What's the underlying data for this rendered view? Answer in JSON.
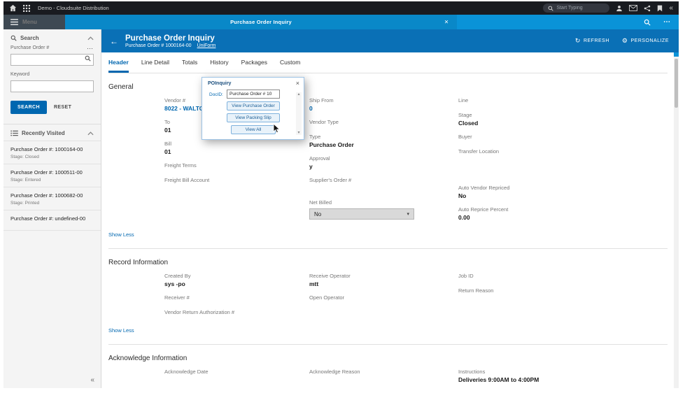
{
  "topbar": {
    "app_title": "Demo - Cloudsuite Distribution",
    "search_placeholder": "Start Typing"
  },
  "menubar": {
    "menu_label": "Menu",
    "tab_title": "Purchase Order Inquiry"
  },
  "page_header": {
    "title": "Purchase Order Inquiry",
    "subtitle": "Purchase Order #  1000164-00",
    "uniform_link": "UniForm",
    "refresh": "REFRESH",
    "personalize": "PERSONALIZE"
  },
  "sidebar": {
    "search_title": "Search",
    "po_number_label": "Purchase Order #",
    "keyword_label": "Keyword",
    "search_button": "SEARCH",
    "reset_button": "RESET",
    "recently_visited_title": "Recently Visited",
    "recent": [
      {
        "title": "Purchase Order #: 1000164-00",
        "stage": "Stage: Closed"
      },
      {
        "title": "Purchase Order #: 1000511-00",
        "stage": "Stage: Entered"
      },
      {
        "title": "Purchase Order #: 1000682-00",
        "stage": "Stage: Printed"
      },
      {
        "title": "Purchase Order #: undefined-00",
        "stage": ""
      }
    ]
  },
  "tabs": {
    "header": "Header",
    "line_detail": "Line Detail",
    "totals": "Totals",
    "history": "History",
    "packages": "Packages",
    "custom": "Custom"
  },
  "sections": {
    "general": {
      "title": "General",
      "show_less": "Show Less",
      "col1": [
        {
          "label": "Vendor #",
          "value": "8022 - WALTON"
        },
        {
          "label": "To",
          "value": "01"
        },
        {
          "label": "Bill",
          "value": "01"
        },
        {
          "label": "Freight Terms",
          "value": ""
        },
        {
          "label": "Freight Bill Account",
          "value": ""
        }
      ],
      "col2": [
        {
          "label": "Ship From",
          "value": "0"
        },
        {
          "label": "Vendor Type",
          "value": ""
        },
        {
          "label": "Type",
          "value": "Purchase Order"
        },
        {
          "label": "Approval",
          "value": "y"
        },
        {
          "label": "Supplier's Order #",
          "value": ""
        },
        {
          "label": "Net Billed",
          "value": "No"
        }
      ],
      "col3": [
        {
          "label": "Line",
          "value": ""
        },
        {
          "label": "Stage",
          "value": "Closed"
        },
        {
          "label": "Buyer",
          "value": ""
        },
        {
          "label": "Transfer Location",
          "value": ""
        },
        {
          "label": "Auto Vendor Repriced",
          "value": "No"
        },
        {
          "label": "Auto Reprice Percent",
          "value": "0.00"
        }
      ]
    },
    "record": {
      "title": "Record Information",
      "show_less": "Show Less",
      "col1": [
        {
          "label": "Created By",
          "value": "sys -po"
        },
        {
          "label": "Receiver #",
          "value": ""
        },
        {
          "label": "Vendor Return Authorization #",
          "value": ""
        }
      ],
      "col2": [
        {
          "label": "Receive Operator",
          "value": "mtt"
        },
        {
          "label": "Open Operator",
          "value": ""
        }
      ],
      "col3": [
        {
          "label": "Job ID",
          "value": ""
        },
        {
          "label": "Return Reason",
          "value": ""
        }
      ]
    },
    "acknowledge": {
      "title": "Acknowledge Information",
      "col1": [
        {
          "label": "Acknowledge Date",
          "value": ""
        }
      ],
      "col2": [
        {
          "label": "Acknowledge Reason",
          "value": ""
        }
      ],
      "col3": [
        {
          "label": "Instructions",
          "value": "Deliveries 9:00AM to 4:00PM"
        }
      ]
    }
  },
  "popup": {
    "title": "POInquiry",
    "docid_label": "DocID:",
    "input_value": "Purchase Order # 10",
    "view_purchase_order": "View Purchase Order",
    "view_packing_slip": "View Packing Slip",
    "view_all": "View All"
  },
  "icons": {
    "back": "←",
    "refresh": "↻",
    "gear": "⚙",
    "close": "×",
    "ellipsis": "⋯",
    "caret_down": "▾",
    "scroll_up": "▴",
    "scroll_down": "▾",
    "collapse_left": "«"
  },
  "colors": {
    "topbar_bg": "#191b20",
    "menubar_bg": "#0a93d8",
    "header_bg": "#0a70b6",
    "accent_blue": "#0067b0"
  }
}
